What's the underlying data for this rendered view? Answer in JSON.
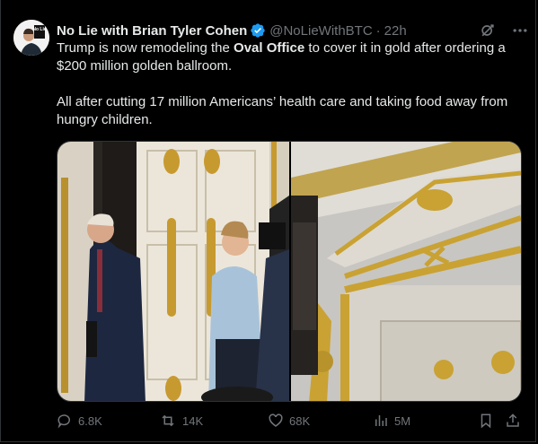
{
  "author": {
    "name": "No Lie with Brian Tyler Cohen",
    "handle": "@NoLieWithBTC",
    "time": "22h",
    "avatar_text": "No Lie"
  },
  "tweet": {
    "line1_pre": "Trump is now remodeling the ",
    "line1_bold": "Oval Office",
    "line1_post": " to cover it in gold after ordering a $200 million golden ballroom.",
    "line2": "All after cutting 17 million Americans’ health care and taking food away from hungry children."
  },
  "actions": {
    "replies": "6.8K",
    "reposts": "14K",
    "likes": "68K",
    "views": "5M"
  },
  "icons": [
    "verified-badge-icon",
    "grok-icon",
    "more-icon",
    "reply-icon",
    "repost-icon",
    "like-icon",
    "views-icon",
    "bookmark-icon",
    "share-icon"
  ],
  "colors": {
    "background": "#000000",
    "text": "#e7e9ea",
    "muted": "#71767b",
    "verified": "#1d9bf0",
    "border": "#2f3336"
  }
}
